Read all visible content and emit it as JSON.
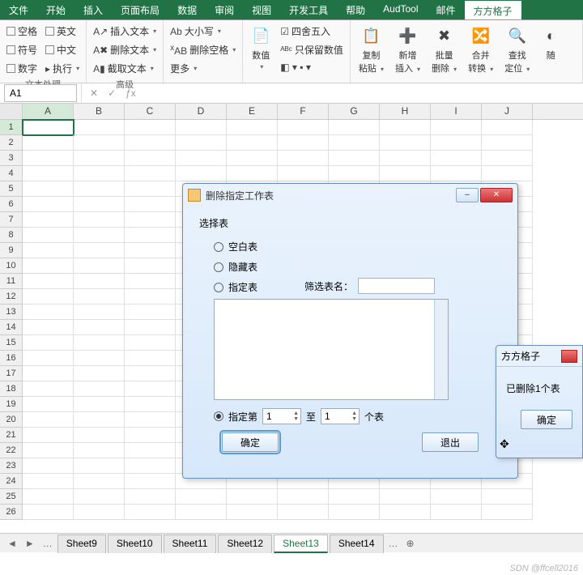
{
  "tabs": [
    "文件",
    "开始",
    "插入",
    "页面布局",
    "数据",
    "审阅",
    "视图",
    "开发工具",
    "帮助",
    "AudTool",
    "邮件",
    "方方格子"
  ],
  "active_tab_index": 11,
  "ribbon": {
    "g1": {
      "items": [
        "空格",
        "英文",
        "符号",
        "中文",
        "数字",
        "执行"
      ],
      "label": "文本处理"
    },
    "g2": {
      "items": [
        "插入文本",
        "删除文本",
        "截取文本"
      ],
      "label": "高级"
    },
    "g3": {
      "items": [
        "大小写",
        "删除空格",
        "更多"
      ]
    },
    "g4": {
      "big": "数值",
      "items": [
        "四舍五入",
        "只保留数值"
      ]
    },
    "g5": {
      "bigs": [
        "复制粘贴",
        "新增插入",
        "批量删除",
        "合并转换",
        "查找定位",
        "随"
      ]
    }
  },
  "namebox": "A1",
  "columns": [
    "A",
    "B",
    "C",
    "D",
    "E",
    "F",
    "G",
    "H",
    "I",
    "J"
  ],
  "rows": 26,
  "dialog": {
    "title": "删除指定工作表",
    "group_title": "选择表",
    "r1": "空白表",
    "r2": "隐藏表",
    "r3": "指定表",
    "filter_label": "筛选表名：",
    "r4": "指定第",
    "from": "1",
    "to_label": "至",
    "to": "1",
    "unit": "个表",
    "ok": "确定",
    "cancel": "退出"
  },
  "popup": {
    "title": "方方格子",
    "msg": "已删除1个表",
    "ok": "确定"
  },
  "sheets": [
    "Sheet9",
    "Sheet10",
    "Sheet11",
    "Sheet12",
    "Sheet13",
    "Sheet14"
  ],
  "active_sheet_index": 4,
  "watermark": "SDN @ffcell2016"
}
